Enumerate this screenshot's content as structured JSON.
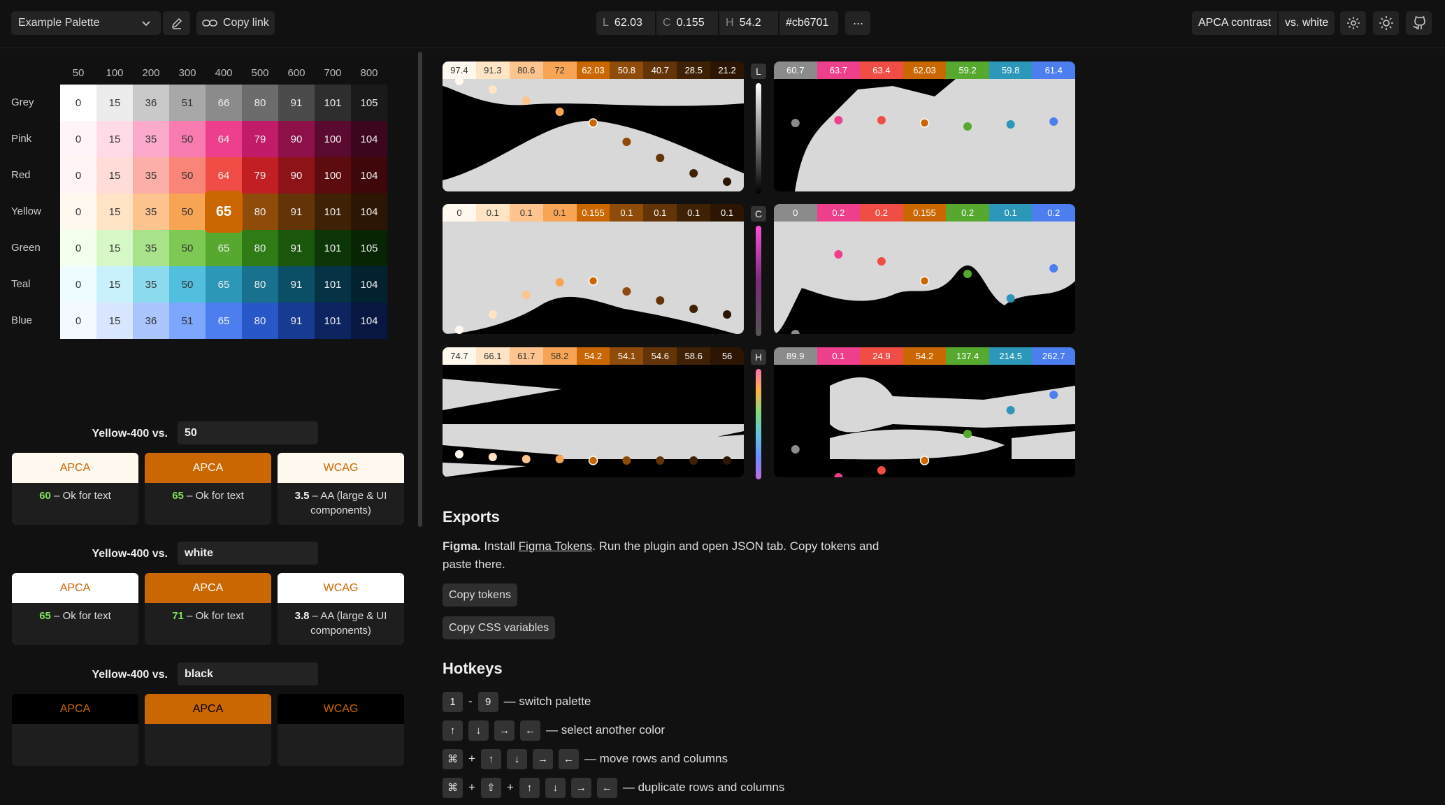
{
  "topbar": {
    "palette_name": "Example Palette",
    "copy_link": "Copy link",
    "l_key": "L",
    "l_val": "62.03",
    "c_key": "C",
    "c_val": "0.155",
    "h_key": "H",
    "h_val": "54.2",
    "hex": "#cb6701",
    "more": "···",
    "contrast_mode": "APCA contrast",
    "vs_mode": "vs. white"
  },
  "palette": {
    "columns": [
      "50",
      "100",
      "200",
      "300",
      "400",
      "500",
      "600",
      "700",
      "800"
    ],
    "rows": [
      {
        "name": "Grey",
        "values": [
          "0",
          "15",
          "36",
          "51",
          "66",
          "80",
          "91",
          "101",
          "105"
        ],
        "colors": [
          "#ffffff",
          "#ececec",
          "#c9c9c9",
          "#a8a8a8",
          "#8b8b8b",
          "#6c6c6c",
          "#4b4b4b",
          "#2e2e2e",
          "#1a1a1a"
        ]
      },
      {
        "name": "Pink",
        "values": [
          "0",
          "15",
          "35",
          "50",
          "64",
          "79",
          "90",
          "100",
          "104"
        ],
        "colors": [
          "#fff4f8",
          "#ffdbe8",
          "#fbaacb",
          "#f87bb0",
          "#ed3f8c",
          "#c11b6a",
          "#8d1049",
          "#5b0a2f",
          "#3d061f"
        ]
      },
      {
        "name": "Red",
        "values": [
          "0",
          "15",
          "35",
          "50",
          "64",
          "79",
          "90",
          "100",
          "104"
        ],
        "colors": [
          "#fff5f4",
          "#ffdcd8",
          "#fbafa7",
          "#f98478",
          "#ef4d45",
          "#c21f25",
          "#8e1319",
          "#5c0b0f",
          "#3e0709"
        ]
      },
      {
        "name": "Yellow",
        "values": [
          "0",
          "15",
          "35",
          "50",
          "65",
          "80",
          "91",
          "101",
          "104"
        ],
        "colors": [
          "#fff8ef",
          "#ffe5c6",
          "#fdc48f",
          "#f7a555",
          "#cb6701",
          "#8f4b0a",
          "#633408",
          "#3f2105",
          "#2c1603"
        ]
      },
      {
        "name": "Green",
        "values": [
          "0",
          "15",
          "35",
          "50",
          "65",
          "80",
          "91",
          "101",
          "105"
        ],
        "colors": [
          "#f4ffee",
          "#d6f7c6",
          "#a8e28b",
          "#7ec954",
          "#56a92e",
          "#2f7c16",
          "#1a560c",
          "#0d3606",
          "#072403"
        ]
      },
      {
        "name": "Teal",
        "values": [
          "0",
          "15",
          "35",
          "50",
          "65",
          "80",
          "91",
          "101",
          "104"
        ],
        "colors": [
          "#eefcff",
          "#c9f1fb",
          "#8cdaee",
          "#52bfde",
          "#2c97b8",
          "#17718f",
          "#0b4f66",
          "#053244",
          "#03222f"
        ]
      },
      {
        "name": "Blue",
        "values": [
          "0",
          "15",
          "36",
          "51",
          "65",
          "80",
          "91",
          "101",
          "104"
        ],
        "colors": [
          "#f4f8ff",
          "#d9e6ff",
          "#abc6ff",
          "#7da6ff",
          "#4d7eef",
          "#2857c7",
          "#173b92",
          "#0c245f",
          "#071741"
        ]
      }
    ],
    "selected": "65"
  },
  "contrast": [
    {
      "label": "Yellow-400 vs.",
      "input": "50",
      "cards": [
        {
          "head": "APCA",
          "score": "60",
          "desc": " – Ok for text",
          "bg": "#fff8ef",
          "fg": "#cb6701"
        },
        {
          "head": "APCA",
          "score": "65",
          "desc": " – Ok for text",
          "bg": "#cb6701",
          "fg": "#fff8ef"
        },
        {
          "head": "WCAG",
          "score": "3.5",
          "desc": " – AA (large & UI components)",
          "bg": "#fff8ef",
          "fg": "#cb6701",
          "white": true
        }
      ]
    },
    {
      "label": "Yellow-400 vs.",
      "input": "white",
      "cards": [
        {
          "head": "APCA",
          "score": "65",
          "desc": " – Ok for text",
          "bg": "#ffffff",
          "fg": "#cb6701"
        },
        {
          "head": "APCA",
          "score": "71",
          "desc": " – Ok for text",
          "bg": "#cb6701",
          "fg": "#ffffff"
        },
        {
          "head": "WCAG",
          "score": "3.8",
          "desc": " – AA (large & UI components)",
          "bg": "#ffffff",
          "fg": "#cb6701",
          "white": true
        }
      ]
    },
    {
      "label": "Yellow-400 vs.",
      "input": "black",
      "cards": [
        {
          "head": "APCA",
          "bg": "#000000",
          "fg": "#cb6701"
        },
        {
          "head": "APCA",
          "bg": "#cb6701",
          "fg": "#000000"
        },
        {
          "head": "WCAG",
          "bg": "#000000",
          "fg": "#cb6701"
        }
      ]
    }
  ],
  "charts": {
    "l_left": {
      "labels": [
        "97.4",
        "91.3",
        "80.6",
        "72",
        "62.03",
        "50.8",
        "40.7",
        "28.5",
        "21.2"
      ],
      "colors": [
        "#fff8ef",
        "#ffe5c6",
        "#fdc48f",
        "#f7a555",
        "#cb6701",
        "#8f4b0a",
        "#633408",
        "#3f2105",
        "#2c1603"
      ]
    },
    "l_right": {
      "labels": [
        "60.7",
        "63.7",
        "63.4",
        "62.03",
        "59.2",
        "59.8",
        "61.4"
      ],
      "colors": [
        "#8b8b8b",
        "#ed3f8c",
        "#ef4d45",
        "#cb6701",
        "#56a92e",
        "#2c97b8",
        "#4d7eef"
      ]
    },
    "c_left": {
      "labels": [
        "0",
        "0.1",
        "0.1",
        "0.1",
        "0.155",
        "0.1",
        "0.1",
        "0.1",
        "0.1"
      ]
    },
    "c_right": {
      "labels": [
        "0",
        "0.2",
        "0.2",
        "0.155",
        "0.2",
        "0.1",
        "0.2"
      ]
    },
    "h_left": {
      "labels": [
        "74.7",
        "66.1",
        "61.7",
        "58.2",
        "54.2",
        "54.1",
        "54.6",
        "58.6",
        "56"
      ]
    },
    "h_right": {
      "labels": [
        "89.9",
        "0.1",
        "24.9",
        "54.2",
        "137.4",
        "214.5",
        "262.7"
      ]
    },
    "axes": {
      "l": "L",
      "c": "C",
      "h": "H"
    }
  },
  "exports": {
    "title": "Exports",
    "figma_bold": "Figma.",
    "figma_text1": " Install ",
    "figma_link": "Figma Tokens",
    "figma_text2": ". Run the plugin and open JSON tab. Copy tokens and paste there.",
    "copy_tokens": "Copy tokens",
    "copy_css": "Copy CSS variables"
  },
  "hotkeys": {
    "title": "Hotkeys",
    "k1": "1",
    "dash": "-",
    "k9": "9",
    "switch": "— switch palette",
    "select": "— select another color",
    "cmd": "⌘",
    "plus": "+",
    "shift": "⇧",
    "move": "— move rows and columns",
    "dup": "— duplicate rows and columns"
  }
}
